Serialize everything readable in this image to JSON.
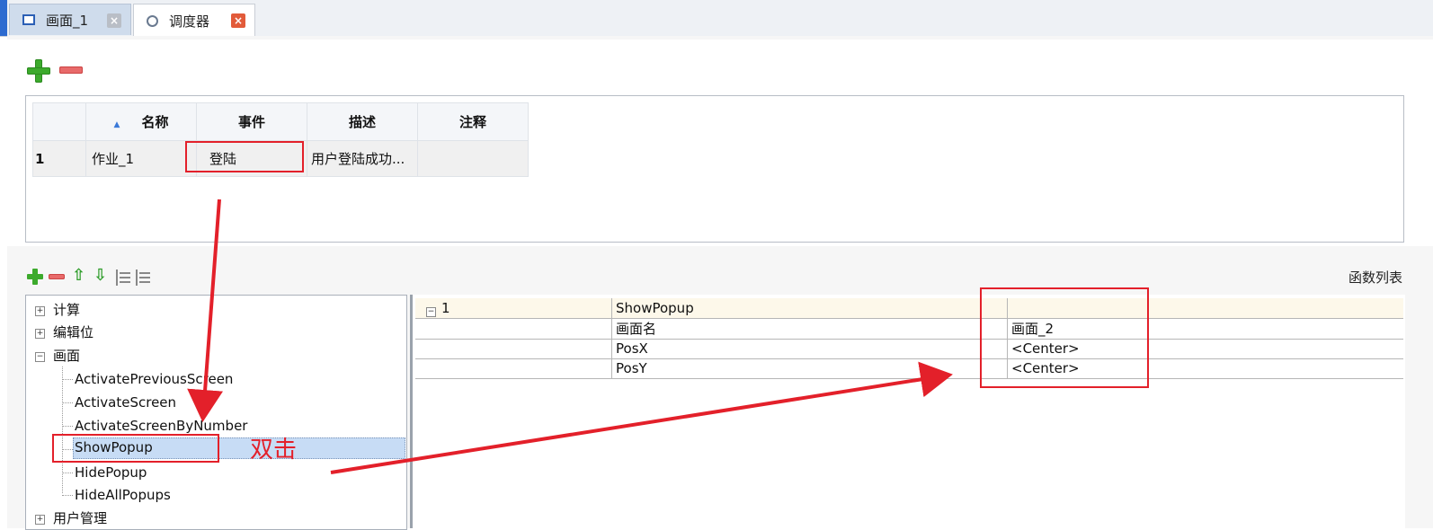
{
  "tabs": [
    {
      "label": "画面_1",
      "icon": "screen-icon",
      "active": false
    },
    {
      "label": "调度器",
      "icon": "scheduler-icon",
      "active": true
    }
  ],
  "event_table": {
    "columns": [
      "名称",
      "事件",
      "描述",
      "注释"
    ],
    "rows": [
      {
        "index": "1",
        "name": "作业_1",
        "event": "登陆",
        "description": "用户登陆成功...",
        "comment": ""
      }
    ]
  },
  "lower_section": {
    "function_list_label": "函数列表"
  },
  "tree": {
    "groups": [
      {
        "label": "计算",
        "expanded": false
      },
      {
        "label": "编辑位",
        "expanded": false
      },
      {
        "label": "画面",
        "expanded": true
      },
      {
        "label": "用户管理",
        "expanded": false
      }
    ],
    "screen_functions": [
      "ActivatePreviousScreen",
      "ActivateScreen",
      "ActivateScreenByNumber",
      "ShowPopup",
      "HidePopup",
      "HideAllPopups"
    ],
    "selected": "ShowPopup"
  },
  "property_grid": {
    "header": {
      "index": "1",
      "function": "ShowPopup"
    },
    "params": [
      {
        "name": "画面名",
        "value": "画面_2"
      },
      {
        "name": "PosX",
        "value": "<Center>"
      },
      {
        "name": "PosY",
        "value": "<Center>"
      }
    ]
  },
  "annotation": {
    "double_click_label": "双击",
    "color": "#e3202a"
  }
}
